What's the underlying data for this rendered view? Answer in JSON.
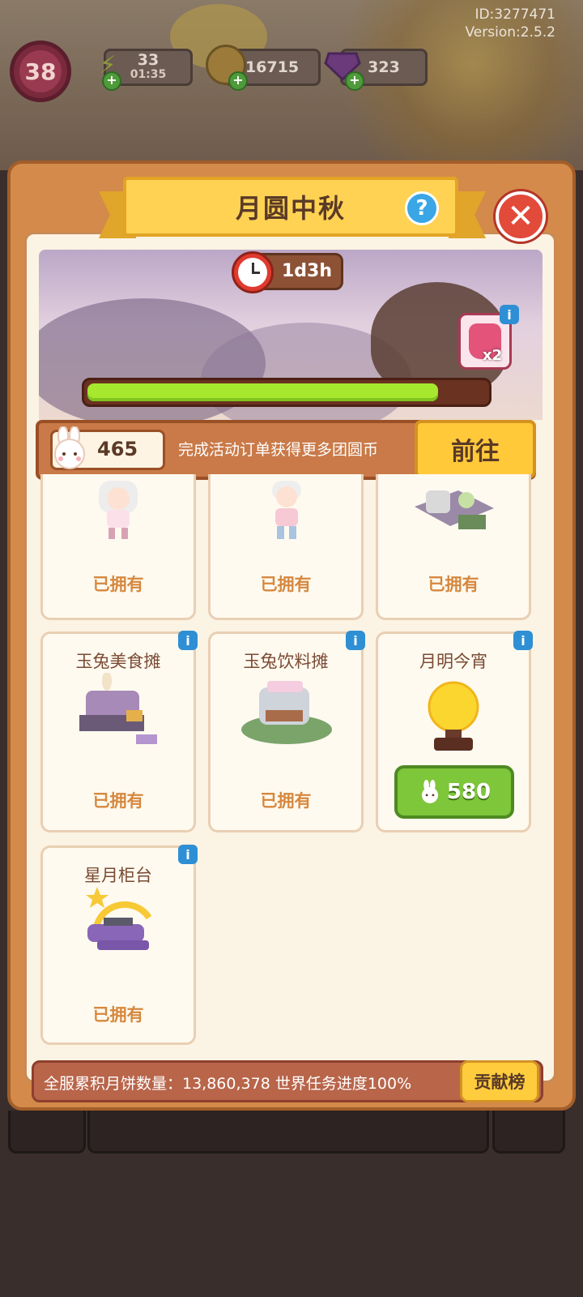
{
  "header": {
    "id_label": "ID:3277471",
    "version_label": "Version:2.5.2"
  },
  "hud": {
    "level": "38",
    "energy": {
      "value": "33",
      "timer": "01:35"
    },
    "coins": {
      "value": "16715"
    },
    "gems": {
      "value": "323"
    }
  },
  "panel": {
    "title": "月圆中秋",
    "help_glyph": "?",
    "close_glyph": "✕",
    "countdown": "1d3h",
    "reward_multiplier": "x2",
    "info_glyph": "i",
    "progress_fraction": 0.88
  },
  "currency": {
    "amount": "465",
    "hint": "完成活动订单获得更多团圆币",
    "go_label": "前往"
  },
  "shop": {
    "items": [
      {
        "name": "",
        "status": "已拥有"
      },
      {
        "name": "",
        "status": "已拥有"
      },
      {
        "name": "",
        "status": "已拥有"
      },
      {
        "name": "玉兔美食摊",
        "status": "已拥有"
      },
      {
        "name": "玉兔饮料摊",
        "status": "已拥有"
      },
      {
        "name": "月明今宵",
        "price": "580"
      },
      {
        "name": "星月柜台",
        "status": "已拥有"
      }
    ]
  },
  "footer": {
    "stats_text": "全服累积月饼数量：13,860,378  世界任务进度100%",
    "rank_label": "贡献榜"
  },
  "colors": {
    "panel_orange": "#d48a4a",
    "title_yellow": "#ffd254",
    "progress_green": "#a6e82e",
    "owned_text": "#d6883e",
    "buy_green": "#7ec63a"
  }
}
